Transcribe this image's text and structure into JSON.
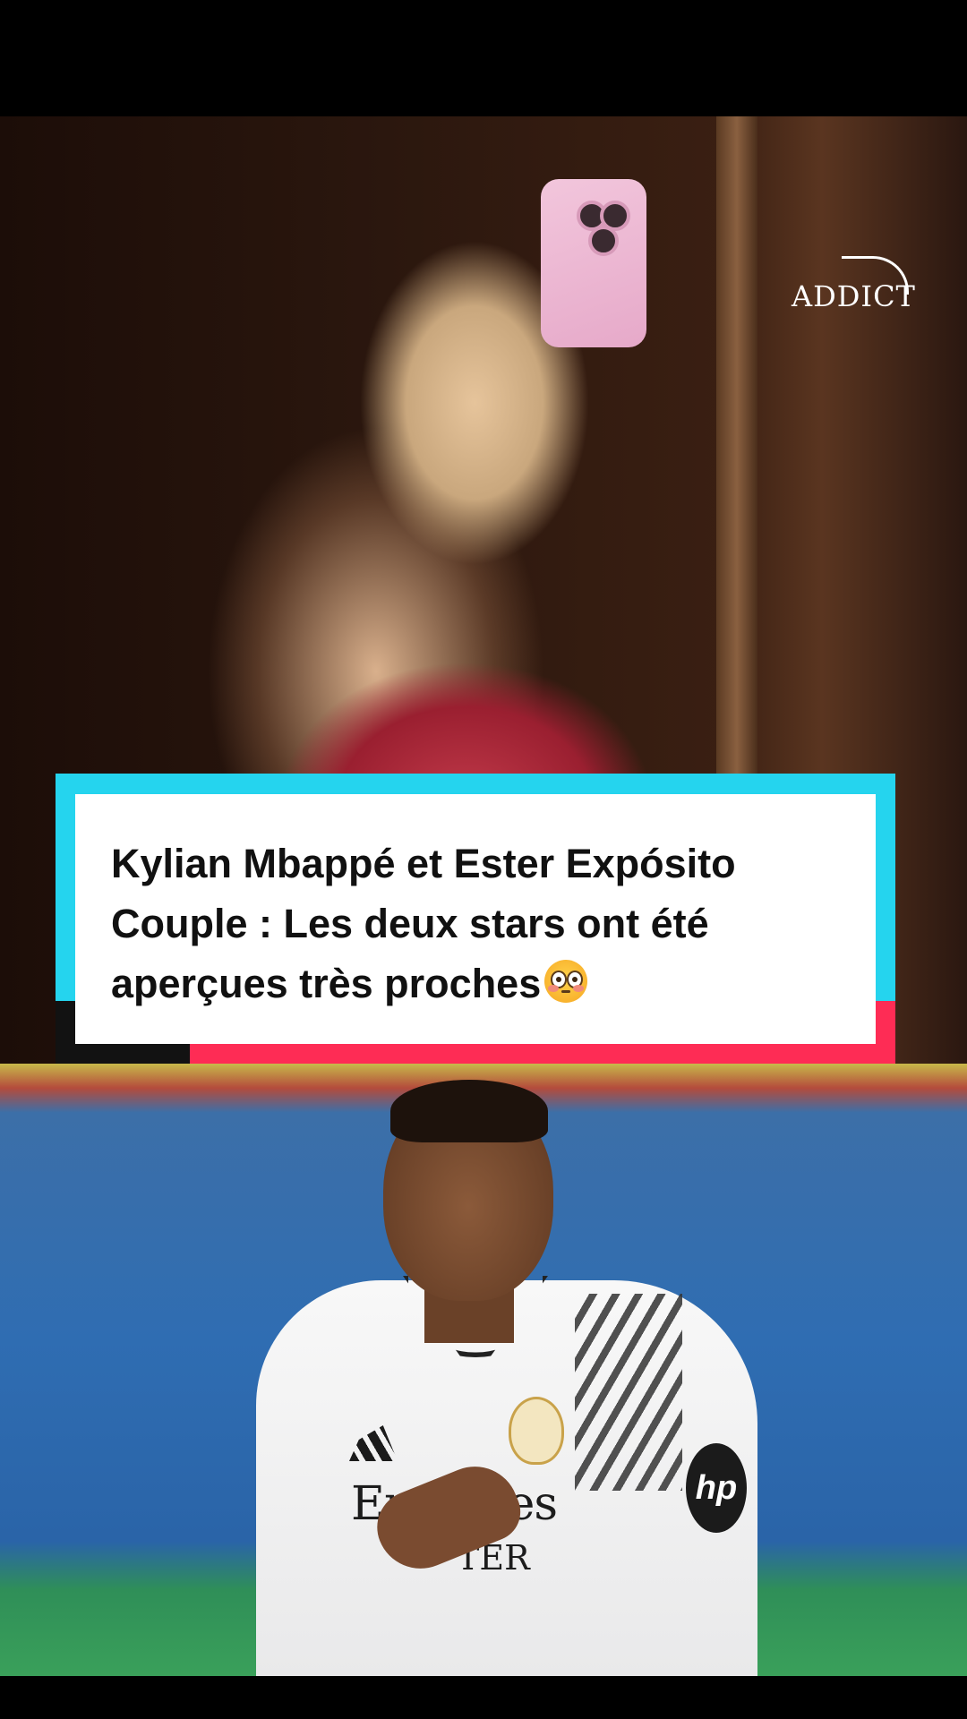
{
  "overlay": {
    "watermark": "ADDICT",
    "headline_lines": [
      "Kylian Mbappé et Ester Expósito",
      "Couple : Les deux stars ont été",
      "aperçues très proches"
    ],
    "emoji": "flushed-face"
  },
  "jersey": {
    "sponsor": "Emirates",
    "sponsor_sub": "TER",
    "badge": "hp"
  },
  "colors": {
    "card_accent_cyan": "#25d4ee",
    "card_accent_red": "#fe2c55",
    "card_bg": "#ffffff",
    "text": "#111111"
  }
}
